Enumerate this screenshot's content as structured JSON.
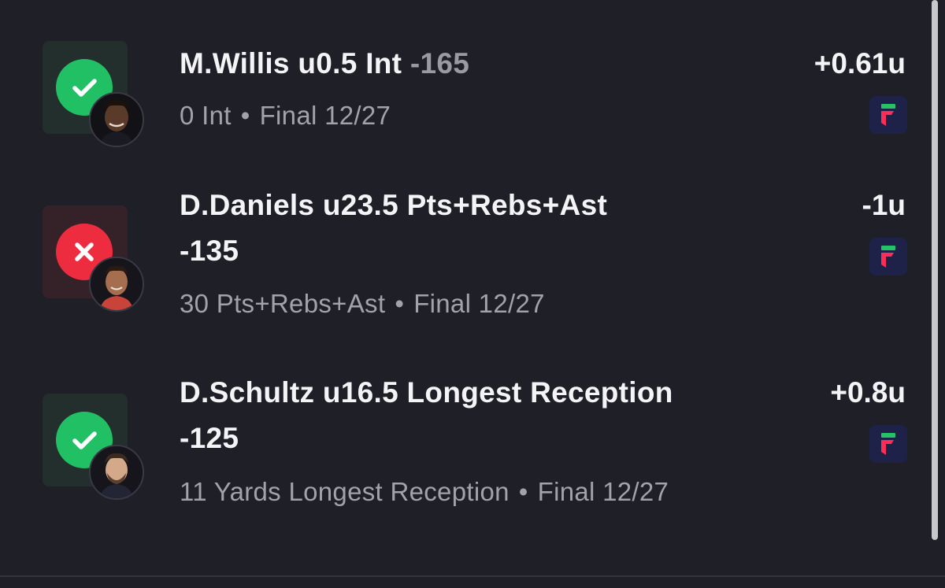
{
  "bets": [
    {
      "status": "win",
      "status_icon": "checkmark-icon",
      "title": "M.Willis u0.5 Int",
      "odds": "-165",
      "result_stat": "0 Int",
      "separator": "•",
      "game_status": "Final 12/27",
      "units": "+0.61u",
      "book": "fliff-logo"
    },
    {
      "status": "loss",
      "status_icon": "x-icon",
      "title": "D.Daniels u23.5 Pts+Rebs+Ast",
      "odds": "-135",
      "result_stat": "30 Pts+Rebs+Ast",
      "separator": "•",
      "game_status": "Final 12/27",
      "units": "-1u",
      "book": "fliff-logo"
    },
    {
      "status": "win",
      "status_icon": "checkmark-icon",
      "title": "D.Schultz u16.5 Longest Reception",
      "odds": "-125",
      "result_stat": "11 Yards Longest Reception",
      "separator": "•",
      "game_status": "Final 12/27",
      "units": "+0.8u",
      "book": "fliff-logo"
    }
  ],
  "colors": {
    "background": "#1f1f28",
    "win": "#21c064",
    "loss": "#ee2c3f",
    "text_primary": "#f4f4f6",
    "text_secondary": "#a2a2ab"
  }
}
